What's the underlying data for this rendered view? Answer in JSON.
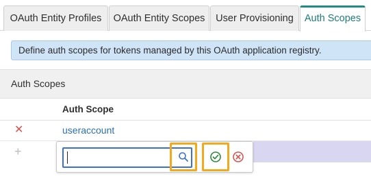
{
  "tabs": [
    {
      "label": "OAuth Entity Profiles",
      "active": false
    },
    {
      "label": "OAuth Entity Scopes",
      "active": false
    },
    {
      "label": "User Provisioning",
      "active": false
    },
    {
      "label": "Auth Scopes",
      "active": true
    }
  ],
  "info_message": "Define auth scopes for tokens managed by this OAuth application registry.",
  "section_title": "Auth Scopes",
  "table": {
    "column_header": "Auth Scope",
    "rows": [
      {
        "value": "useraccount"
      }
    ]
  },
  "editor": {
    "value": "",
    "search_icon": "search-icon",
    "confirm_icon": "check-circle-icon",
    "cancel_icon": "x-circle-icon"
  },
  "colors": {
    "accent_tab": "#1c8c84",
    "link": "#2a6fb8",
    "delete": "#d9534f",
    "highlight_box": "#f4a81b",
    "info_bg": "#cfe4f7"
  }
}
